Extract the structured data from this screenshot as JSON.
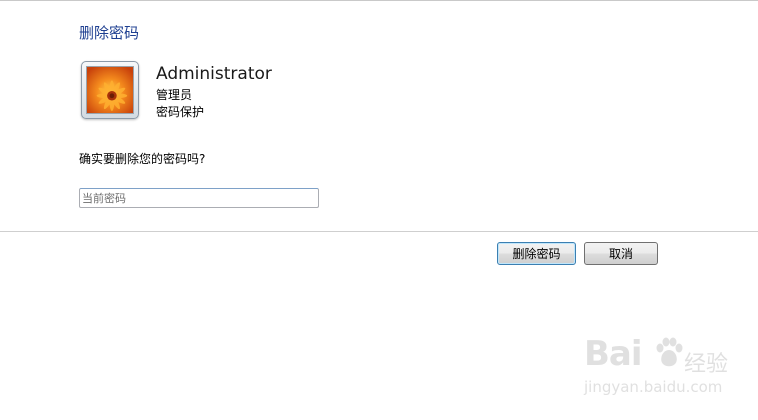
{
  "page": {
    "title": "删除密码"
  },
  "user": {
    "name": "Administrator",
    "role": "管理员",
    "status": "密码保护",
    "avatar_icon": "flower-avatar-icon"
  },
  "form": {
    "question": "确实要删除您的密码吗?",
    "current_password": {
      "placeholder": "当前密码",
      "value": ""
    }
  },
  "actions": {
    "delete_label": "删除密码",
    "cancel_label": "取消"
  },
  "watermark": {
    "brand": "Bai",
    "brand_suffix": "经验",
    "url": "jingyan.baidu.com"
  },
  "colors": {
    "title": "#1e3f91",
    "primary_border": "#3c7fb1"
  }
}
